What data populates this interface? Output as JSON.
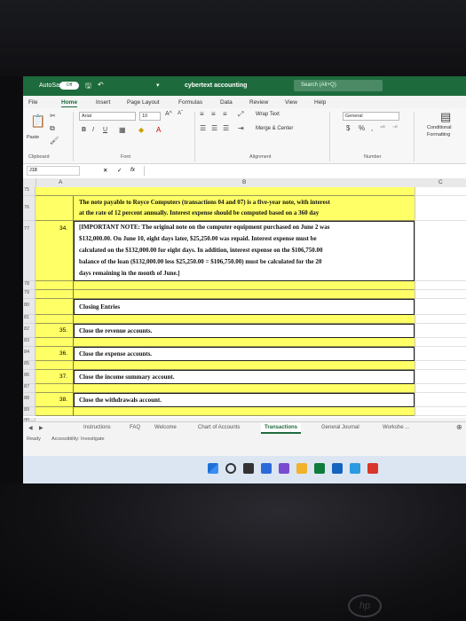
{
  "titlebar": {
    "autosave_label": "AutoSave",
    "autosave_state": "Off",
    "doc_title": "cybertext accounting",
    "search_text": "Search (Alt+Q)"
  },
  "menu": {
    "file": "File",
    "home": "Home",
    "insert": "Insert",
    "page_layout": "Page Layout",
    "formulas": "Formulas",
    "data": "Data",
    "review": "Review",
    "view": "View",
    "help": "Help"
  },
  "ribbon": {
    "paste": "Paste",
    "font_name": "Arial",
    "font_size": "10",
    "bold": "B",
    "italic": "I",
    "underline": "U",
    "wrap_text": "Wrap Text",
    "merge_center": "Merge & Center",
    "number_format": "General",
    "currency": "$",
    "percent": "%",
    "comma": ",",
    "conditional": "Conditional",
    "formatting": "Formatting",
    "groups": {
      "clipboard": "Clipboard",
      "font": "Font",
      "alignment": "Alignment",
      "number": "Number"
    }
  },
  "formula_bar": {
    "name_box": "J18",
    "fx": "fx",
    "cancel": "✕",
    "enter": "✓"
  },
  "columns": {
    "a": "A",
    "b": "B",
    "c": "C"
  },
  "rows": {
    "r75": {
      "num": "75",
      "a": "",
      "b": ""
    },
    "r76": {
      "num": "76",
      "b1": "The note payable to Royce Computers (transactions 04 and 07) is a five-year note, with interest",
      "b2": "at the rate of 12 percent annually. Interest expense should be computed based on a 360 day"
    },
    "r77": {
      "num": "77",
      "a": "34.",
      "b1": "[IMPORTANT NOTE: The original note on the computer equipment purchased on June 2 was",
      "b2": "$132,000.00. On June 10, eight days later, $25,250.00 was repaid. Interest expense must be",
      "b3": "calculated on the $132,000.00 for eight days. In addition, interest expense on the $106,750.00",
      "b4": "balance of the loan ($132,000.00 less $25,250.00 = $106,750.00) must be calculated for the 20",
      "b5": "days remaining in the month of June.]"
    },
    "r78": {
      "num": "78"
    },
    "r79": {
      "num": "79"
    },
    "r80": {
      "num": "80",
      "b": "Closing Entries"
    },
    "r81": {
      "num": "81"
    },
    "r82": {
      "num": "82",
      "a": "35.",
      "b": "Close the revenue accounts."
    },
    "r83": {
      "num": "83"
    },
    "r84": {
      "num": "84",
      "a": "36.",
      "b": "Close the expense accounts."
    },
    "r85": {
      "num": "85"
    },
    "r86": {
      "num": "86",
      "a": "37.",
      "b": "Close the income summary account."
    },
    "r87": {
      "num": "87"
    },
    "r88": {
      "num": "88",
      "a": "38.",
      "b": "Close the withdrawals account."
    },
    "r89": {
      "num": "89"
    },
    "r90": {
      "num": "90"
    }
  },
  "tabs": {
    "t1": "Instructions",
    "t2": "FAQ",
    "t3": "Welcome",
    "t4": "Chart of Accounts",
    "t5": "Transactions",
    "t6": "General Journal",
    "t7": "Workshe ..."
  },
  "status": {
    "ready": "Ready",
    "accessibility": "Accessibility: Investigate"
  },
  "colors": {
    "excel_green": "#1d6b3c",
    "cell_yellow": "#ffff66"
  }
}
